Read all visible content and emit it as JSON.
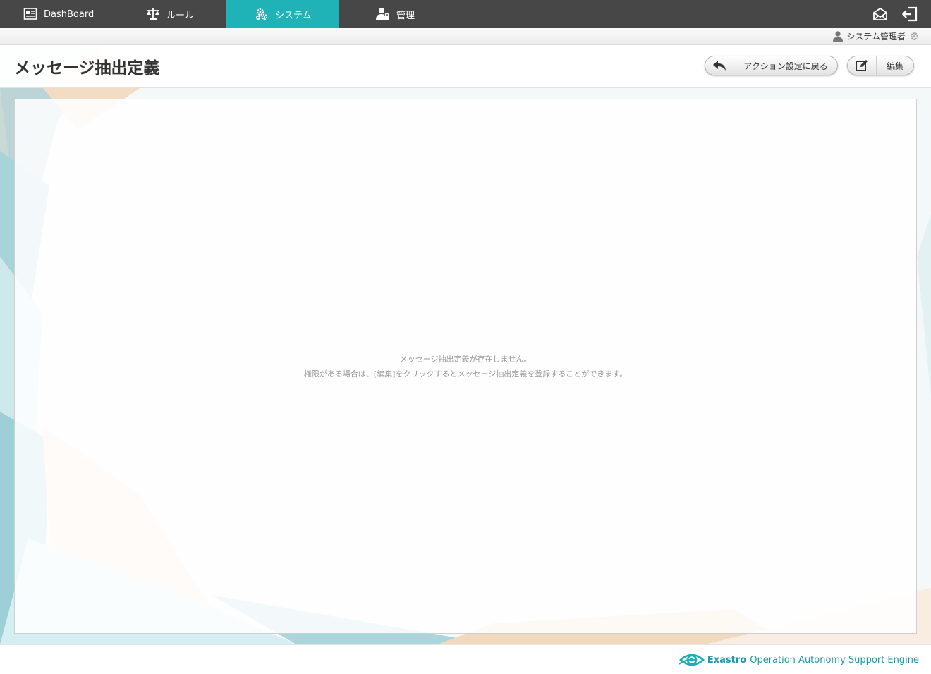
{
  "nav": {
    "tabs": [
      {
        "label": "DashBoard",
        "icon": "dashboard-icon"
      },
      {
        "label": "ルール",
        "icon": "scales-icon"
      },
      {
        "label": "システム",
        "icon": "gears-icon",
        "active": true
      },
      {
        "label": "管理",
        "icon": "user-lock-icon"
      }
    ],
    "actions": [
      {
        "icon": "mail-icon"
      },
      {
        "icon": "logout-icon"
      }
    ]
  },
  "user": {
    "name": "システム管理者",
    "icon": "user-icon",
    "settings_icon": "gear-icon"
  },
  "page": {
    "title": "メッセージ抽出定義",
    "back_button": "アクション設定に戻る",
    "edit_button": "編集"
  },
  "empty_state": {
    "line1": "メッセージ抽出定義が存在しません。",
    "line2": "権限がある場合は、[編集]をクリックするとメッセージ抽出定義を登録することができます。"
  },
  "footer": {
    "brand_bold": "Exastro",
    "brand_rest": "Operation Autonomy Support Engine"
  },
  "colors": {
    "nav_bg": "#474747",
    "accent": "#1fb3b8",
    "brand": "#1a9aa8"
  }
}
